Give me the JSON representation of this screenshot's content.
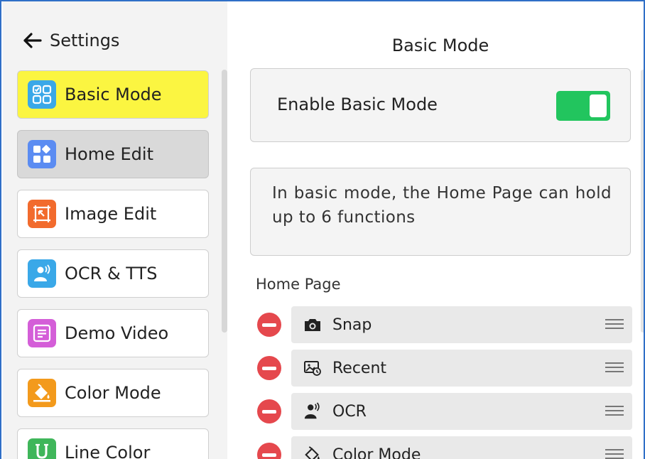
{
  "header": {
    "back_label": "Settings"
  },
  "sidebar": {
    "items": [
      {
        "label": "Basic Mode",
        "icon": "basic-mode-icon",
        "color": "#3aa8e8",
        "state": "selected"
      },
      {
        "label": "Home Edit",
        "icon": "home-edit-icon",
        "color": "#5b8cf2",
        "state": "hover"
      },
      {
        "label": "Image Edit",
        "icon": "image-edit-icon",
        "color": "#f26b2d",
        "state": "normal"
      },
      {
        "label": "OCR & TTS",
        "icon": "ocr-tts-icon",
        "color": "#3aa8e8",
        "state": "normal"
      },
      {
        "label": "Demo Video",
        "icon": "demo-video-icon",
        "color": "#d45ed8",
        "state": "normal"
      },
      {
        "label": "Color Mode",
        "icon": "color-mode-icon",
        "color": "#f39a1c",
        "state": "normal"
      },
      {
        "label": "Line Color",
        "icon": "line-color-icon",
        "color": "#3fb65a",
        "state": "normal"
      }
    ]
  },
  "main": {
    "title": "Basic Mode",
    "toggle": {
      "label": "Enable Basic Mode",
      "on": true,
      "color": "#22c55e"
    },
    "info": "In basic mode, the Home Page can hold up to 6 functions",
    "section_label": "Home Page",
    "functions": [
      {
        "label": "Snap",
        "icon": "camera-icon"
      },
      {
        "label": "Recent",
        "icon": "recent-icon"
      },
      {
        "label": "OCR",
        "icon": "ocr-icon"
      },
      {
        "label": "Color Mode",
        "icon": "paint-bucket-icon"
      }
    ]
  },
  "colors": {
    "selected": "#fbf541",
    "remove": "#e5484d",
    "frame": "#2f6fc7"
  }
}
